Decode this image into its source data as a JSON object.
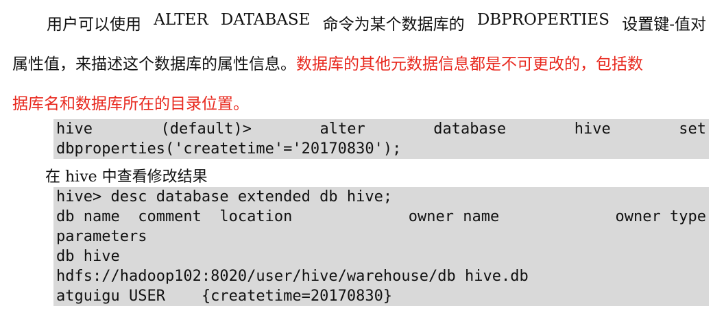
{
  "paragraph": {
    "line1_words": [
      "用户可以使用",
      "ALTER",
      "DATABASE",
      "命令为某个数据库的",
      "DBPROPERTIES",
      "设置键-值对"
    ],
    "line2_black": "属性值，来描述这个数据库的属性信息。",
    "line2_red": "数据库的其他元数据信息都是不可更改的，包括数",
    "line3_red": "据库名和数据库所在的目录位置。"
  },
  "code_block_1": {
    "line1_tokens": [
      "hive",
      "(default)>",
      "alter",
      "database",
      "hive",
      "set"
    ],
    "line2": "dbproperties('createtime'='20170830');"
  },
  "subheading": "在 hive 中查看修改结果",
  "code_block_2": {
    "line1": "hive> desc database extended db hive;",
    "line2_tokens": [
      "db name  comment  location",
      "owner name",
      "owner type"
    ],
    "line3": "parameters",
    "line4": "db hive",
    "line5": "hdfs://hadoop102:8020/user/hive/warehouse/db hive.db",
    "line6": "atguigu USER    {createtime=20170830}"
  }
}
